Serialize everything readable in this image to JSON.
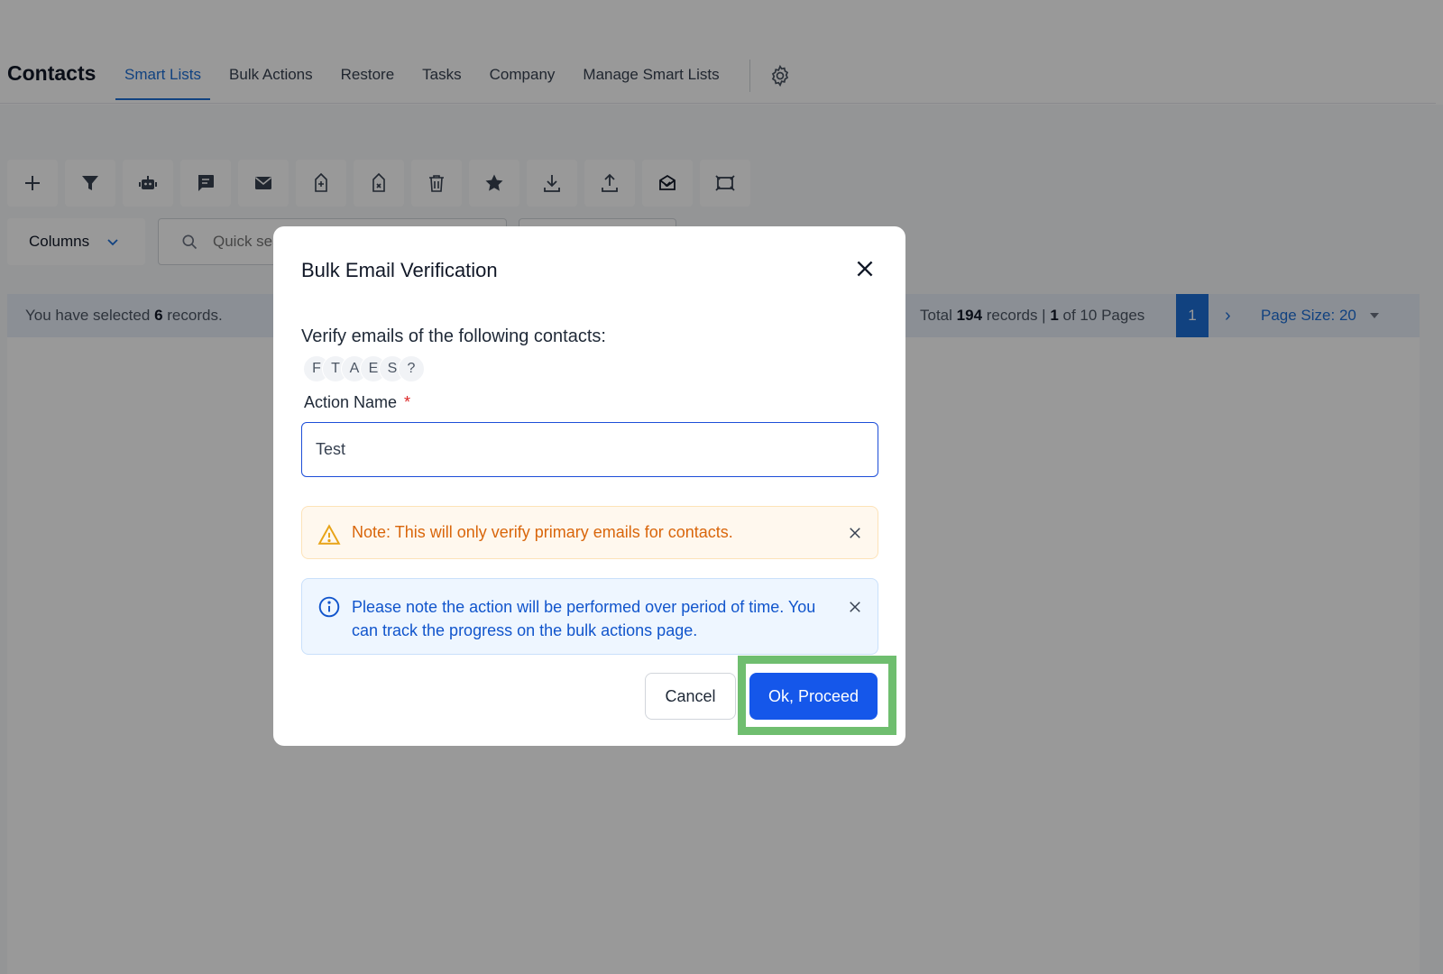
{
  "app": {
    "title": "Contacts",
    "tabs": [
      {
        "label": "Smart Lists",
        "active": true
      },
      {
        "label": "Bulk Actions",
        "active": false
      },
      {
        "label": "Restore",
        "active": false
      },
      {
        "label": "Tasks",
        "active": false
      },
      {
        "label": "Company",
        "active": false
      },
      {
        "label": "Manage Smart Lists",
        "active": false
      }
    ],
    "settings_icon": "gear-icon"
  },
  "toolbar": {
    "icons": [
      "plus-icon",
      "filter-icon",
      "robot-icon",
      "message-icon",
      "email-icon",
      "add-tag-icon",
      "remove-tag-icon",
      "trash-icon",
      "star-icon",
      "download-icon",
      "upload-icon",
      "email-verify-icon",
      "merge-icon"
    ]
  },
  "list_controls": {
    "columns_label": "Columns",
    "search_placeholder": "Quick search"
  },
  "records_bar": {
    "selected_prefix": "You have selected",
    "selected_count": "6",
    "selected_suffix": "records.",
    "total_prefix": "Total",
    "total_count": "194",
    "total_mid": "records |",
    "current_page": "1",
    "pages_text": "of 10 Pages",
    "page_button": "1",
    "next_symbol": "›",
    "page_size_label": "Page Size: 20"
  },
  "modal": {
    "title": "Bulk Email Verification",
    "prompt": "Verify emails of the following contacts:",
    "avatars": [
      "F",
      "T",
      "A",
      "E",
      "S",
      "?"
    ],
    "field_label": "Action Name",
    "required_mark": "*",
    "action_name_value": "Test ",
    "warning_text": "Note: This will only verify primary emails for contacts.",
    "info_text": "Please note the action will be performed over period of time. You can track the progress on the bulk actions page.",
    "cancel_label": "Cancel",
    "proceed_label": "Ok, Proceed"
  },
  "colors": {
    "accent": "#1d6fd6",
    "primary_button": "#1557ea",
    "warning": "#d9660b",
    "info": "#1155cc",
    "highlight": "#6fbe6f"
  }
}
